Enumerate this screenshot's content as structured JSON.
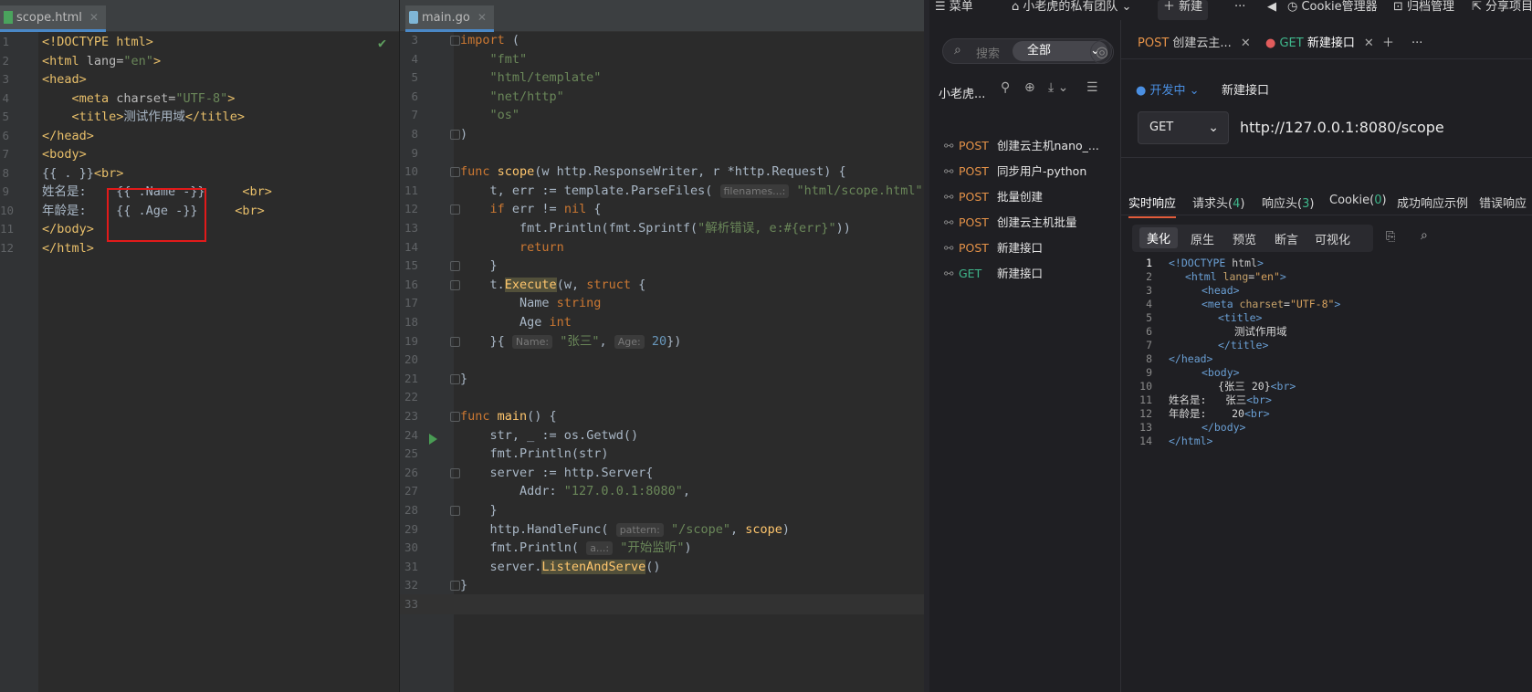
{
  "html_editor": {
    "tab_label": "scope.html",
    "lines": [
      {
        "n": "1",
        "parts": [
          [
            "tag",
            "<!DOCTYPE html>"
          ]
        ]
      },
      {
        "n": "2",
        "parts": [
          [
            "tag",
            "<html "
          ],
          [
            "attr",
            "lang="
          ],
          [
            "str",
            "\"en\""
          ],
          [
            "tag",
            ">"
          ]
        ]
      },
      {
        "n": "3",
        "parts": [
          [
            "tag",
            "<head>"
          ]
        ]
      },
      {
        "n": "4",
        "parts": [
          [
            "txt",
            "    "
          ],
          [
            "tag",
            "<meta "
          ],
          [
            "attr",
            "charset="
          ],
          [
            "str",
            "\"UTF-8\""
          ],
          [
            "tag",
            ">"
          ]
        ]
      },
      {
        "n": "5",
        "parts": [
          [
            "txt",
            "    "
          ],
          [
            "tag",
            "<title>"
          ],
          [
            "txt",
            "测试作用域"
          ],
          [
            "tag",
            "</title>"
          ]
        ]
      },
      {
        "n": "6",
        "parts": [
          [
            "tag",
            "</head>"
          ]
        ]
      },
      {
        "n": "7",
        "parts": [
          [
            "tag",
            "<body>"
          ]
        ]
      },
      {
        "n": "8",
        "parts": [
          [
            "txt",
            "{{ . }}"
          ],
          [
            "tag",
            "<br>"
          ]
        ]
      },
      {
        "n": "9",
        "parts": [
          [
            "txt",
            "姓名是:    {{ .Name -}}     "
          ],
          [
            "tag",
            "<br>"
          ]
        ]
      },
      {
        "n": "10",
        "parts": [
          [
            "txt",
            "年龄是:    {{ .Age -}}     "
          ],
          [
            "tag",
            "<br>"
          ]
        ]
      },
      {
        "n": "11",
        "parts": [
          [
            "tag",
            "</body>"
          ]
        ]
      },
      {
        "n": "12",
        "parts": [
          [
            "tag",
            "</html>"
          ]
        ]
      }
    ]
  },
  "go_editor": {
    "tab_label": "main.go",
    "lines": [
      {
        "n": "3",
        "parts": [
          [
            "kw",
            "import "
          ],
          [
            "txt",
            "("
          ]
        ]
      },
      {
        "n": "4",
        "parts": [
          [
            "txt",
            "    "
          ],
          [
            "str",
            "\"fmt\""
          ]
        ]
      },
      {
        "n": "5",
        "parts": [
          [
            "txt",
            "    "
          ],
          [
            "str",
            "\"html/template\""
          ]
        ]
      },
      {
        "n": "6",
        "parts": [
          [
            "txt",
            "    "
          ],
          [
            "str",
            "\"net/http\""
          ]
        ]
      },
      {
        "n": "7",
        "parts": [
          [
            "txt",
            "    "
          ],
          [
            "str",
            "\"os\""
          ]
        ]
      },
      {
        "n": "8",
        "parts": [
          [
            "txt",
            ")"
          ]
        ]
      },
      {
        "n": "9",
        "parts": []
      },
      {
        "n": "10",
        "parts": [
          [
            "kw",
            "func "
          ],
          [
            "fn",
            "scope"
          ],
          [
            "txt",
            "(w "
          ],
          [
            "pkg",
            "http."
          ],
          [
            "txt",
            "ResponseWriter, r *"
          ],
          [
            "pkg",
            "http."
          ],
          [
            "txt",
            "Request) {"
          ]
        ]
      },
      {
        "n": "11",
        "parts": [
          [
            "txt",
            "    t, err := "
          ],
          [
            "pkg",
            "template."
          ],
          [
            "txt",
            "ParseFiles( "
          ],
          [
            "hint",
            "filenames...:"
          ],
          [
            "txt",
            " "
          ],
          [
            "str",
            "\"html/scope.html\""
          ],
          [
            "txt",
            ")"
          ]
        ]
      },
      {
        "n": "12",
        "parts": [
          [
            "txt",
            "    "
          ],
          [
            "kw",
            "if "
          ],
          [
            "txt",
            "err != "
          ],
          [
            "kw",
            "nil "
          ],
          [
            "txt",
            "{"
          ]
        ]
      },
      {
        "n": "13",
        "parts": [
          [
            "txt",
            "        "
          ],
          [
            "pkg",
            "fmt."
          ],
          [
            "txt",
            "Println("
          ],
          [
            "pkg",
            "fmt."
          ],
          [
            "txt",
            "Sprintf("
          ],
          [
            "str",
            "\"解析错误, e:#{err}\""
          ],
          [
            "txt",
            "))"
          ]
        ]
      },
      {
        "n": "14",
        "parts": [
          [
            "txt",
            "        "
          ],
          [
            "kw",
            "return"
          ]
        ]
      },
      {
        "n": "15",
        "parts": [
          [
            "txt",
            "    }"
          ]
        ]
      },
      {
        "n": "16",
        "parts": [
          [
            "txt",
            "    t."
          ],
          [
            "hlfn",
            "Execute"
          ],
          [
            "txt",
            "(w, "
          ],
          [
            "kw",
            "struct "
          ],
          [
            "txt",
            "{"
          ]
        ]
      },
      {
        "n": "17",
        "parts": [
          [
            "txt",
            "        Name "
          ],
          [
            "kw",
            "string"
          ]
        ]
      },
      {
        "n": "18",
        "parts": [
          [
            "txt",
            "        Age "
          ],
          [
            "kw",
            "int"
          ]
        ]
      },
      {
        "n": "19",
        "parts": [
          [
            "txt",
            "    }{ "
          ],
          [
            "hint",
            "Name:"
          ],
          [
            "txt",
            " "
          ],
          [
            "str",
            "\"张三\""
          ],
          [
            "txt",
            ", "
          ],
          [
            "hint",
            "Age:"
          ],
          [
            "txt",
            " "
          ],
          [
            "num",
            "20"
          ],
          [
            "txt",
            "})"
          ]
        ]
      },
      {
        "n": "20",
        "parts": []
      },
      {
        "n": "21",
        "parts": [
          [
            "txt",
            "}"
          ]
        ]
      },
      {
        "n": "22",
        "parts": []
      },
      {
        "n": "23",
        "parts": [
          [
            "kw",
            "func "
          ],
          [
            "fn",
            "main"
          ],
          [
            "txt",
            "() {"
          ]
        ]
      },
      {
        "n": "24",
        "parts": [
          [
            "txt",
            "    str, _ := "
          ],
          [
            "pkg",
            "os."
          ],
          [
            "txt",
            "Getwd()"
          ]
        ]
      },
      {
        "n": "25",
        "parts": [
          [
            "txt",
            "    "
          ],
          [
            "pkg",
            "fmt."
          ],
          [
            "txt",
            "Println(str)"
          ]
        ]
      },
      {
        "n": "26",
        "parts": [
          [
            "txt",
            "    server := "
          ],
          [
            "pkg",
            "http."
          ],
          [
            "txt",
            "Server{"
          ]
        ]
      },
      {
        "n": "27",
        "parts": [
          [
            "txt",
            "        Addr: "
          ],
          [
            "str",
            "\"127.0.0.1:8080\""
          ],
          [
            "txt",
            ","
          ]
        ]
      },
      {
        "n": "28",
        "parts": [
          [
            "txt",
            "    }"
          ]
        ]
      },
      {
        "n": "29",
        "parts": [
          [
            "txt",
            "    "
          ],
          [
            "pkg",
            "http."
          ],
          [
            "txt",
            "HandleFunc( "
          ],
          [
            "hint",
            "pattern:"
          ],
          [
            "txt",
            " "
          ],
          [
            "str",
            "\"/scope\""
          ],
          [
            "txt",
            ", "
          ],
          [
            "fn",
            "scope"
          ],
          [
            "txt",
            ")"
          ]
        ]
      },
      {
        "n": "30",
        "parts": [
          [
            "txt",
            "    "
          ],
          [
            "pkg",
            "fmt."
          ],
          [
            "txt",
            "Println( "
          ],
          [
            "hint",
            "a...:"
          ],
          [
            "txt",
            " "
          ],
          [
            "str",
            "\"开始监听\""
          ],
          [
            "txt",
            ")"
          ]
        ]
      },
      {
        "n": "31",
        "parts": [
          [
            "txt",
            "    server."
          ],
          [
            "hlfn",
            "ListenAndServe"
          ],
          [
            "txt",
            "()"
          ]
        ]
      },
      {
        "n": "32",
        "parts": [
          [
            "txt",
            "}"
          ]
        ]
      },
      {
        "n": "33",
        "parts": []
      }
    ]
  },
  "api_tool": {
    "topbar": {
      "menu": "菜单",
      "team": "小老虎的私有团队",
      "new": "新建",
      "more": "···",
      "cookie": "Cookie管理器",
      "archive": "归档管理",
      "share": "分享项目"
    },
    "search": {
      "placeholder": "搜索",
      "scope": "全部"
    },
    "project_name": "小老虎...",
    "api_list": [
      {
        "method": "POST",
        "name": "创建云主机nano_..."
      },
      {
        "method": "POST",
        "name": "同步用户-python"
      },
      {
        "method": "POST",
        "name": "批量创建"
      },
      {
        "method": "POST",
        "name": "创建云主机批量"
      },
      {
        "method": "POST",
        "name": "新建接口"
      },
      {
        "method": "GET",
        "name": "新建接口"
      }
    ],
    "tabs": [
      {
        "method": "POST",
        "label": "创建云主..."
      },
      {
        "method": "GET",
        "label": "新建接口"
      }
    ],
    "env": "开发中",
    "request_name": "新建接口",
    "method": "GET",
    "url": "http://127.0.0.1:8080/scope",
    "response_tabs": [
      {
        "label": "实时响应",
        "count": ""
      },
      {
        "label": "请求头(",
        "count": "4",
        "suffix": ")"
      },
      {
        "label": "响应头(",
        "count": "3",
        "suffix": ")"
      },
      {
        "label": "Cookie(",
        "count": "0",
        "suffix": ")"
      },
      {
        "label": "成功响应示例",
        "count": ""
      },
      {
        "label": "错误响应",
        "count": ""
      }
    ],
    "view_modes": [
      "美化",
      "原生",
      "预览",
      "断言",
      "可视化"
    ],
    "response_lines": [
      {
        "n": "1",
        "indent": 0,
        "parts": [
          [
            "rtag",
            "<!DOCTYPE "
          ],
          [
            "rkw",
            "html"
          ],
          [
            "rtag",
            ">"
          ]
        ]
      },
      {
        "n": "2",
        "indent": 1,
        "parts": [
          [
            "rtag",
            "<html "
          ],
          [
            "rattr",
            "lang"
          ],
          [
            "rtxt",
            "="
          ],
          [
            "rstr",
            "\"en\""
          ],
          [
            "rtag",
            ">"
          ]
        ]
      },
      {
        "n": "3",
        "indent": 2,
        "parts": [
          [
            "rtag",
            "<head>"
          ]
        ]
      },
      {
        "n": "4",
        "indent": 2,
        "parts": [
          [
            "rtag",
            "<meta "
          ],
          [
            "rattr",
            "charset"
          ],
          [
            "rtxt",
            "="
          ],
          [
            "rstr",
            "\"UTF-8\""
          ],
          [
            "rtag",
            ">"
          ]
        ]
      },
      {
        "n": "5",
        "indent": 3,
        "parts": [
          [
            "rtag",
            "<title>"
          ]
        ]
      },
      {
        "n": "6",
        "indent": 4,
        "parts": [
          [
            "rtxt",
            "测试作用域"
          ]
        ]
      },
      {
        "n": "7",
        "indent": 3,
        "parts": [
          [
            "rtag",
            "</title>"
          ]
        ]
      },
      {
        "n": "8",
        "indent": 0,
        "parts": [
          [
            "rtag",
            "</head>"
          ]
        ]
      },
      {
        "n": "9",
        "indent": 2,
        "parts": [
          [
            "rtag",
            "<body>"
          ]
        ]
      },
      {
        "n": "10",
        "indent": 3,
        "parts": [
          [
            "rtxt",
            "{张三 20}"
          ],
          [
            "rtag",
            "<br>"
          ]
        ]
      },
      {
        "n": "11",
        "indent": 0,
        "parts": [
          [
            "rtxt",
            "姓名是:   张三"
          ],
          [
            "rtag",
            "<br>"
          ]
        ]
      },
      {
        "n": "12",
        "indent": 0,
        "parts": [
          [
            "rtxt",
            "年龄是:    20"
          ],
          [
            "rtag",
            "<br>"
          ]
        ]
      },
      {
        "n": "13",
        "indent": 2,
        "parts": [
          [
            "rtag",
            "</body>"
          ]
        ]
      },
      {
        "n": "14",
        "indent": 0,
        "parts": [
          [
            "rtag",
            "</html>"
          ]
        ]
      }
    ]
  }
}
